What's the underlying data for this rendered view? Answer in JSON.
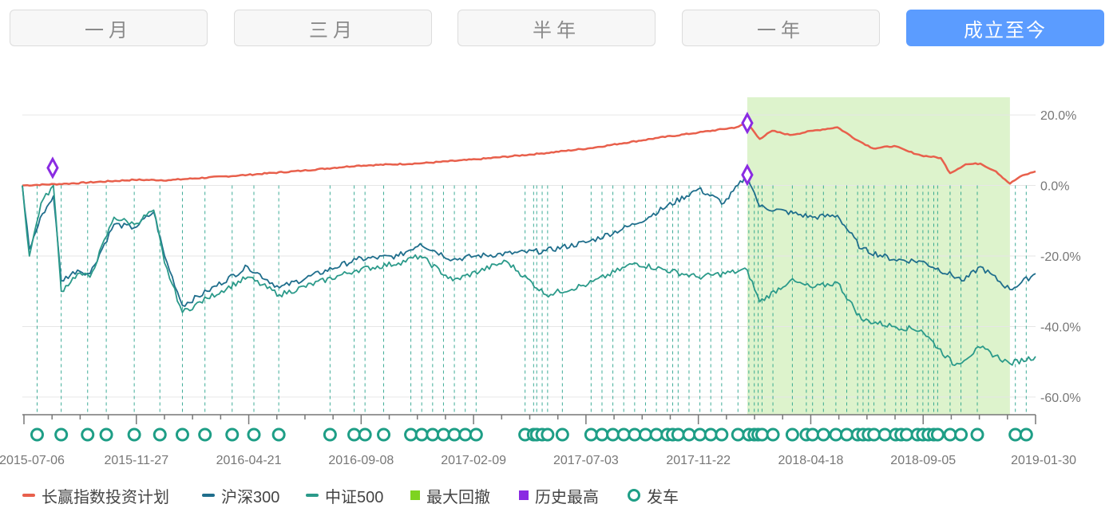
{
  "tabs": [
    {
      "label": "一月",
      "active": false
    },
    {
      "label": "三月",
      "active": false
    },
    {
      "label": "半年",
      "active": false
    },
    {
      "label": "一年",
      "active": false
    },
    {
      "label": "成立至今",
      "active": true
    }
  ],
  "colors": {
    "plan": "#e8604c",
    "hs300": "#1f6e8c",
    "zz500": "#2b9a8a",
    "drawdown": "#d9f2c7",
    "peak": "#8a2be2",
    "trip": "#1e9e86",
    "axis": "#777777",
    "grid": "#e6e6e6"
  },
  "chart_data": {
    "type": "line",
    "x_range": [
      "2015-07-06",
      "2019-01-30"
    ],
    "ylim": [
      -65,
      25
    ],
    "y_ticks": [
      20,
      0,
      -20,
      -40,
      -60
    ],
    "y_tick_labels": [
      "20.0%",
      "0.0%",
      "-20.0%",
      "-40.0%",
      "-60.0%"
    ],
    "x_tick_labels": [
      "2015-07-06",
      "2015-11-27",
      "2016-04-21",
      "2016-09-08",
      "2017-02-09",
      "2017-07-03",
      "2017-11-22",
      "2018-04-18",
      "2018-09-05",
      "2019-01-30"
    ],
    "series": [
      {
        "name": "长赢指数投资计划",
        "color": "#e8604c",
        "points": [
          [
            "2015-07-06",
            0.0
          ],
          [
            "2015-09-01",
            0.5
          ],
          [
            "2015-11-27",
            1.6
          ],
          [
            "2016-01-10",
            1.5
          ],
          [
            "2016-04-21",
            3.0
          ],
          [
            "2016-07-01",
            4.2
          ],
          [
            "2016-09-08",
            5.6
          ],
          [
            "2016-12-01",
            6.3
          ],
          [
            "2017-02-09",
            7.4
          ],
          [
            "2017-05-01",
            9.0
          ],
          [
            "2017-07-03",
            10.5
          ],
          [
            "2017-10-01",
            13.5
          ],
          [
            "2017-11-22",
            15.0
          ],
          [
            "2018-01-10",
            16.5
          ],
          [
            "2018-01-24",
            17.7
          ],
          [
            "2018-02-09",
            13.2
          ],
          [
            "2018-02-25",
            15.5
          ],
          [
            "2018-03-20",
            14.3
          ],
          [
            "2018-04-18",
            15.5
          ],
          [
            "2018-05-20",
            16.5
          ],
          [
            "2018-06-15",
            12.8
          ],
          [
            "2018-07-05",
            10.5
          ],
          [
            "2018-08-01",
            11.2
          ],
          [
            "2018-08-20",
            9.6
          ],
          [
            "2018-09-05",
            8.5
          ],
          [
            "2018-09-30",
            7.8
          ],
          [
            "2018-10-12",
            3.5
          ],
          [
            "2018-11-01",
            6.0
          ],
          [
            "2018-11-20",
            6.2
          ],
          [
            "2018-12-10",
            4.0
          ],
          [
            "2018-12-28",
            0.5
          ],
          [
            "2019-01-10",
            2.5
          ],
          [
            "2019-01-30",
            4.0
          ]
        ]
      },
      {
        "name": "沪深300",
        "color": "#1f6e8c",
        "points": [
          [
            "2015-07-06",
            0.0
          ],
          [
            "2015-07-15",
            -18.0
          ],
          [
            "2015-08-01",
            -8.0
          ],
          [
            "2015-08-15",
            -3.0
          ],
          [
            "2015-08-25",
            -27.0
          ],
          [
            "2015-09-15",
            -24.0
          ],
          [
            "2015-10-01",
            -25.0
          ],
          [
            "2015-11-01",
            -11.0
          ],
          [
            "2015-11-27",
            -12.0
          ],
          [
            "2015-12-22",
            -7.5
          ],
          [
            "2016-01-05",
            -20.0
          ],
          [
            "2016-01-28",
            -34.0
          ],
          [
            "2016-02-29",
            -30.0
          ],
          [
            "2016-04-21",
            -23.0
          ],
          [
            "2016-06-01",
            -29.0
          ],
          [
            "2016-09-08",
            -21.0
          ],
          [
            "2016-11-01",
            -20.0
          ],
          [
            "2016-11-29",
            -16.5
          ],
          [
            "2017-01-10",
            -21.0
          ],
          [
            "2017-02-09",
            -20.0
          ],
          [
            "2017-05-10",
            -18.5
          ],
          [
            "2017-07-03",
            -16.0
          ],
          [
            "2017-09-01",
            -11.0
          ],
          [
            "2017-11-22",
            -1.0
          ],
          [
            "2017-12-25",
            -5.0
          ],
          [
            "2018-01-24",
            3.0
          ],
          [
            "2018-02-09",
            -6.0
          ],
          [
            "2018-04-18",
            -9.0
          ],
          [
            "2018-05-20",
            -8.5
          ],
          [
            "2018-06-20",
            -18.0
          ],
          [
            "2018-08-01",
            -21.0
          ],
          [
            "2018-09-05",
            -21.5
          ],
          [
            "2018-10-30",
            -27.0
          ],
          [
            "2018-11-20",
            -23.0
          ],
          [
            "2018-12-28",
            -29.5
          ],
          [
            "2019-01-30",
            -25.0
          ]
        ]
      },
      {
        "name": "中证500",
        "color": "#2b9a8a",
        "points": [
          [
            "2015-07-06",
            0.0
          ],
          [
            "2015-07-15",
            -20.0
          ],
          [
            "2015-07-30",
            -5.0
          ],
          [
            "2015-08-15",
            0.0
          ],
          [
            "2015-08-25",
            -30.0
          ],
          [
            "2015-09-15",
            -25.0
          ],
          [
            "2015-10-01",
            -26.0
          ],
          [
            "2015-11-01",
            -9.0
          ],
          [
            "2015-11-27",
            -11.0
          ],
          [
            "2015-12-22",
            -7.0
          ],
          [
            "2016-01-05",
            -22.0
          ],
          [
            "2016-01-28",
            -36.0
          ],
          [
            "2016-02-29",
            -32.0
          ],
          [
            "2016-04-21",
            -26.0
          ],
          [
            "2016-06-01",
            -31.0
          ],
          [
            "2016-09-08",
            -24.0
          ],
          [
            "2016-11-01",
            -22.0
          ],
          [
            "2016-11-29",
            -20.0
          ],
          [
            "2017-01-10",
            -27.0
          ],
          [
            "2017-03-20",
            -21.5
          ],
          [
            "2017-05-10",
            -31.0
          ],
          [
            "2017-07-03",
            -28.0
          ],
          [
            "2017-09-01",
            -22.0
          ],
          [
            "2017-11-22",
            -26.0
          ],
          [
            "2018-01-24",
            -24.0
          ],
          [
            "2018-02-09",
            -33.0
          ],
          [
            "2018-03-20",
            -27.0
          ],
          [
            "2018-04-18",
            -29.0
          ],
          [
            "2018-05-20",
            -27.5
          ],
          [
            "2018-06-20",
            -38.0
          ],
          [
            "2018-08-01",
            -40.0
          ],
          [
            "2018-09-05",
            -41.0
          ],
          [
            "2018-10-18",
            -51.0
          ],
          [
            "2018-11-20",
            -46.0
          ],
          [
            "2018-12-28",
            -50.5
          ],
          [
            "2019-01-30",
            -48.5
          ]
        ]
      }
    ],
    "max_drawdown": {
      "name": "最大回撤",
      "color": "#7ed321",
      "start": "2018-01-24",
      "end": "2018-12-28"
    },
    "all_time_high": {
      "name": "历史最高",
      "color": "#8a2be2",
      "points": [
        [
          "2015-08-14",
          5.0
        ],
        [
          "2018-01-24",
          17.7
        ],
        [
          "2018-01-24",
          3.0
        ]
      ]
    },
    "trips": {
      "name": "发车",
      "color": "#1e9e86",
      "dates": [
        "2015-07-25",
        "2015-08-25",
        "2015-09-28",
        "2015-10-22",
        "2015-11-27",
        "2015-12-30",
        "2016-01-28",
        "2016-02-26",
        "2016-04-01",
        "2016-04-29",
        "2016-05-31",
        "2016-08-05",
        "2016-09-05",
        "2016-09-19",
        "2016-10-13",
        "2016-11-17",
        "2016-12-01",
        "2016-12-15",
        "2016-12-29",
        "2017-01-12",
        "2017-01-26",
        "2017-02-09",
        "2017-04-13",
        "2017-04-24",
        "2017-04-28",
        "2017-05-05",
        "2017-05-12",
        "2017-05-31",
        "2017-07-07",
        "2017-07-21",
        "2017-08-04",
        "2017-08-18",
        "2017-09-01",
        "2017-09-15",
        "2017-09-29",
        "2017-10-13",
        "2017-10-20",
        "2017-10-27",
        "2017-11-10",
        "2017-11-24",
        "2017-12-08",
        "2017-12-22",
        "2018-01-12",
        "2018-01-26",
        "2018-02-02",
        "2018-02-07",
        "2018-02-12",
        "2018-02-26",
        "2018-03-23",
        "2018-04-10",
        "2018-04-18",
        "2018-05-02",
        "2018-05-18",
        "2018-06-01",
        "2018-06-15",
        "2018-06-22",
        "2018-06-29",
        "2018-07-06",
        "2018-07-20",
        "2018-08-03",
        "2018-08-10",
        "2018-08-17",
        "2018-08-31",
        "2018-09-07",
        "2018-09-14",
        "2018-09-21",
        "2018-09-26",
        "2018-10-12",
        "2018-10-26",
        "2018-11-16",
        "2019-01-04",
        "2019-01-18"
      ]
    }
  },
  "legend": [
    {
      "label": "长赢指数投资计划",
      "kind": "line",
      "color": "#e8604c"
    },
    {
      "label": "沪深300",
      "kind": "line",
      "color": "#1f6e8c"
    },
    {
      "label": "中证500",
      "kind": "line",
      "color": "#2b9a8a"
    },
    {
      "label": "最大回撤",
      "kind": "box",
      "color": "#7ed321"
    },
    {
      "label": "历史最高",
      "kind": "box",
      "color": "#8a2be2"
    },
    {
      "label": "发车",
      "kind": "ring",
      "color": "#1e9e86"
    }
  ]
}
